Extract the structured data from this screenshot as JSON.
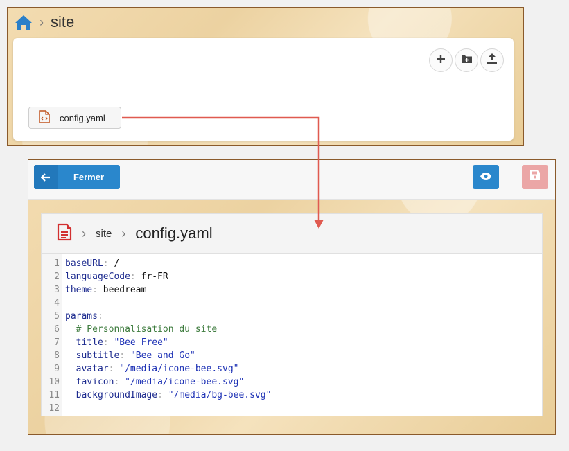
{
  "browser": {
    "breadcrumb": {
      "home_icon": "home-icon",
      "current": "site"
    },
    "actions": [
      {
        "icon": "plus-icon"
      },
      {
        "icon": "folder-plus-icon"
      },
      {
        "icon": "upload-icon"
      }
    ],
    "files": [
      {
        "name": "config.yaml",
        "icon": "code-file-icon"
      }
    ]
  },
  "editor": {
    "close_label": "Fermer",
    "preview_icon": "eye-icon",
    "save_icon": "save-icon",
    "breadcrumb": {
      "folder": "site",
      "file": "config.yaml"
    },
    "line_numbers": [
      "1",
      "2",
      "3",
      "4",
      "5",
      "6",
      "7",
      "8",
      "9",
      "10",
      "11",
      "12"
    ],
    "lines": [
      {
        "key": "baseURL",
        "value": " /"
      },
      {
        "key": "languageCode",
        "value": " fr-FR"
      },
      {
        "key": "theme",
        "value": " beedream"
      },
      {},
      {
        "key": "params"
      },
      {
        "comment": "  # Personnalisation du site"
      },
      {
        "indent": "  ",
        "key": "title",
        "str": " \"Bee Free\""
      },
      {
        "indent": "  ",
        "key": "subtitle",
        "str": " \"Bee and Go\""
      },
      {
        "indent": "  ",
        "key": "avatar",
        "str": " \"/media/icone-bee.svg\""
      },
      {
        "indent": "  ",
        "key": "favicon",
        "str": " \"/media/icone-bee.svg\""
      },
      {
        "indent": "  ",
        "key": "backgroundImage",
        "str": " \"/media/bg-bee.svg\""
      },
      {}
    ]
  },
  "colors": {
    "primary": "#2a87cc",
    "save_disabled": "#eba6a6",
    "connector": "#e05a50",
    "file_icon": "#c0531e",
    "doc_icon": "#d23030"
  }
}
